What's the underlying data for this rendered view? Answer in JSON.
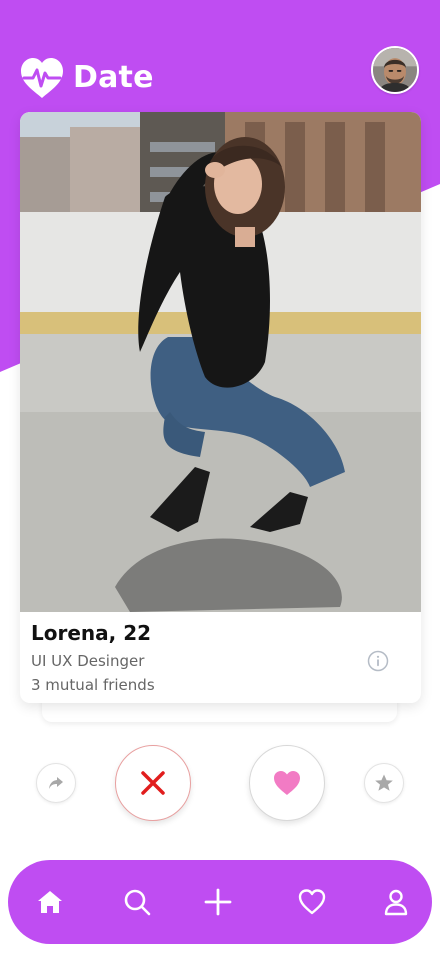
{
  "app": {
    "title": "Date",
    "brand_color": "#bf4df2",
    "logo_icon": "heartbeat-icon"
  },
  "header": {
    "avatar_icon": "user-avatar-photo"
  },
  "profile": {
    "name_age": "Lorena, 22",
    "job": "UI UX Desinger",
    "mutual_friends": "3 mutual friends",
    "info_icon": "info-icon"
  },
  "actions": [
    {
      "name": "share",
      "icon": "share-arrow-icon",
      "color": "#a8a8a8"
    },
    {
      "name": "dislike",
      "icon": "close-x-icon",
      "color": "#e11d1d"
    },
    {
      "name": "like",
      "icon": "heart-icon",
      "color": "#f27bc4"
    },
    {
      "name": "favorite",
      "icon": "star-icon",
      "color": "#a8a8a8"
    }
  ],
  "bottom_nav": [
    {
      "name": "home",
      "icon": "home-icon",
      "active": true
    },
    {
      "name": "search",
      "icon": "search-icon"
    },
    {
      "name": "add",
      "icon": "plus-icon"
    },
    {
      "name": "likes",
      "icon": "heart-outline-icon"
    },
    {
      "name": "profile",
      "icon": "user-icon"
    }
  ]
}
